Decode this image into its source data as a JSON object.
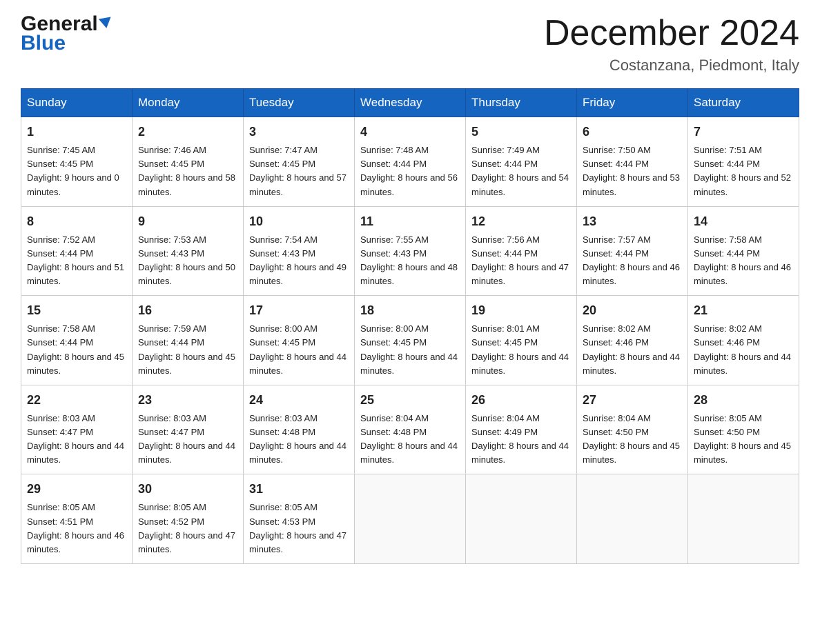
{
  "header": {
    "logo_general": "General",
    "logo_blue": "Blue",
    "month_title": "December 2024",
    "location": "Costanzana, Piedmont, Italy"
  },
  "days_of_week": [
    "Sunday",
    "Monday",
    "Tuesday",
    "Wednesday",
    "Thursday",
    "Friday",
    "Saturday"
  ],
  "weeks": [
    [
      {
        "day": "1",
        "sunrise": "7:45 AM",
        "sunset": "4:45 PM",
        "daylight": "9 hours and 0 minutes."
      },
      {
        "day": "2",
        "sunrise": "7:46 AM",
        "sunset": "4:45 PM",
        "daylight": "8 hours and 58 minutes."
      },
      {
        "day": "3",
        "sunrise": "7:47 AM",
        "sunset": "4:45 PM",
        "daylight": "8 hours and 57 minutes."
      },
      {
        "day": "4",
        "sunrise": "7:48 AM",
        "sunset": "4:44 PM",
        "daylight": "8 hours and 56 minutes."
      },
      {
        "day": "5",
        "sunrise": "7:49 AM",
        "sunset": "4:44 PM",
        "daylight": "8 hours and 54 minutes."
      },
      {
        "day": "6",
        "sunrise": "7:50 AM",
        "sunset": "4:44 PM",
        "daylight": "8 hours and 53 minutes."
      },
      {
        "day": "7",
        "sunrise": "7:51 AM",
        "sunset": "4:44 PM",
        "daylight": "8 hours and 52 minutes."
      }
    ],
    [
      {
        "day": "8",
        "sunrise": "7:52 AM",
        "sunset": "4:44 PM",
        "daylight": "8 hours and 51 minutes."
      },
      {
        "day": "9",
        "sunrise": "7:53 AM",
        "sunset": "4:43 PM",
        "daylight": "8 hours and 50 minutes."
      },
      {
        "day": "10",
        "sunrise": "7:54 AM",
        "sunset": "4:43 PM",
        "daylight": "8 hours and 49 minutes."
      },
      {
        "day": "11",
        "sunrise": "7:55 AM",
        "sunset": "4:43 PM",
        "daylight": "8 hours and 48 minutes."
      },
      {
        "day": "12",
        "sunrise": "7:56 AM",
        "sunset": "4:44 PM",
        "daylight": "8 hours and 47 minutes."
      },
      {
        "day": "13",
        "sunrise": "7:57 AM",
        "sunset": "4:44 PM",
        "daylight": "8 hours and 46 minutes."
      },
      {
        "day": "14",
        "sunrise": "7:58 AM",
        "sunset": "4:44 PM",
        "daylight": "8 hours and 46 minutes."
      }
    ],
    [
      {
        "day": "15",
        "sunrise": "7:58 AM",
        "sunset": "4:44 PM",
        "daylight": "8 hours and 45 minutes."
      },
      {
        "day": "16",
        "sunrise": "7:59 AM",
        "sunset": "4:44 PM",
        "daylight": "8 hours and 45 minutes."
      },
      {
        "day": "17",
        "sunrise": "8:00 AM",
        "sunset": "4:45 PM",
        "daylight": "8 hours and 44 minutes."
      },
      {
        "day": "18",
        "sunrise": "8:00 AM",
        "sunset": "4:45 PM",
        "daylight": "8 hours and 44 minutes."
      },
      {
        "day": "19",
        "sunrise": "8:01 AM",
        "sunset": "4:45 PM",
        "daylight": "8 hours and 44 minutes."
      },
      {
        "day": "20",
        "sunrise": "8:02 AM",
        "sunset": "4:46 PM",
        "daylight": "8 hours and 44 minutes."
      },
      {
        "day": "21",
        "sunrise": "8:02 AM",
        "sunset": "4:46 PM",
        "daylight": "8 hours and 44 minutes."
      }
    ],
    [
      {
        "day": "22",
        "sunrise": "8:03 AM",
        "sunset": "4:47 PM",
        "daylight": "8 hours and 44 minutes."
      },
      {
        "day": "23",
        "sunrise": "8:03 AM",
        "sunset": "4:47 PM",
        "daylight": "8 hours and 44 minutes."
      },
      {
        "day": "24",
        "sunrise": "8:03 AM",
        "sunset": "4:48 PM",
        "daylight": "8 hours and 44 minutes."
      },
      {
        "day": "25",
        "sunrise": "8:04 AM",
        "sunset": "4:48 PM",
        "daylight": "8 hours and 44 minutes."
      },
      {
        "day": "26",
        "sunrise": "8:04 AM",
        "sunset": "4:49 PM",
        "daylight": "8 hours and 44 minutes."
      },
      {
        "day": "27",
        "sunrise": "8:04 AM",
        "sunset": "4:50 PM",
        "daylight": "8 hours and 45 minutes."
      },
      {
        "day": "28",
        "sunrise": "8:05 AM",
        "sunset": "4:50 PM",
        "daylight": "8 hours and 45 minutes."
      }
    ],
    [
      {
        "day": "29",
        "sunrise": "8:05 AM",
        "sunset": "4:51 PM",
        "daylight": "8 hours and 46 minutes."
      },
      {
        "day": "30",
        "sunrise": "8:05 AM",
        "sunset": "4:52 PM",
        "daylight": "8 hours and 47 minutes."
      },
      {
        "day": "31",
        "sunrise": "8:05 AM",
        "sunset": "4:53 PM",
        "daylight": "8 hours and 47 minutes."
      },
      null,
      null,
      null,
      null
    ]
  ]
}
